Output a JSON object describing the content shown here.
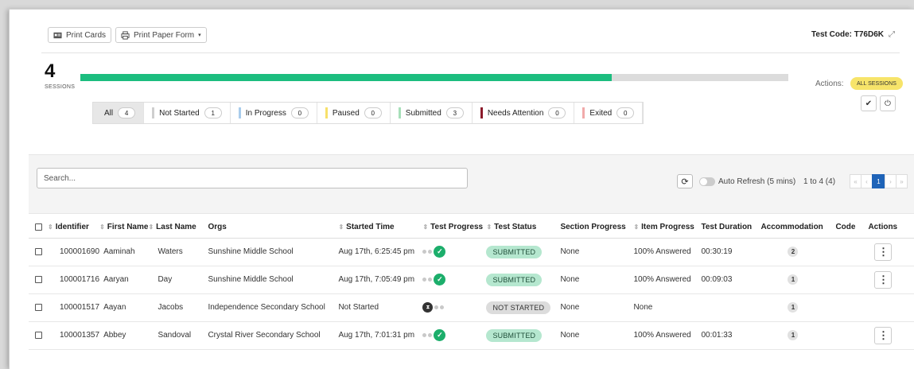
{
  "toolbar": {
    "print_cards": "Print Cards",
    "print_paper_form": "Print Paper Form",
    "test_code_label": "Test Code:",
    "test_code": "T76D6K"
  },
  "summary": {
    "sessions_count": "4",
    "sessions_label": "SESSIONS",
    "progress_fraction": 0.75,
    "actions_label": "Actions:",
    "all_sessions_pill": "ALL SESSIONS"
  },
  "filters": [
    {
      "label": "All",
      "count": "4",
      "color": ""
    },
    {
      "label": "Not Started",
      "count": "1",
      "color": "#cfcfcf"
    },
    {
      "label": "In Progress",
      "count": "0",
      "color": "#a9ccec"
    },
    {
      "label": "Paused",
      "count": "0",
      "color": "#f7e06a"
    },
    {
      "label": "Submitted",
      "count": "3",
      "color": "#a7dfb9"
    },
    {
      "label": "Needs Attention",
      "count": "0",
      "color": "#8b1a2b"
    },
    {
      "label": "Exited",
      "count": "0",
      "color": "#f1aaaa"
    }
  ],
  "search": {
    "placeholder": "Search..."
  },
  "refresh": {
    "auto_label": "Auto Refresh (5 mins)",
    "range_label": "1 to 4 (4)",
    "current_page": "1"
  },
  "table": {
    "headers": {
      "identifier": "Identifier",
      "first_name": "First Name",
      "last_name": "Last Name",
      "orgs": "Orgs",
      "started_time": "Started Time",
      "test_progress": "Test Progress",
      "test_status": "Test Status",
      "section_progress": "Section Progress",
      "item_progress": "Item Progress",
      "test_duration": "Test Duration",
      "accommodation": "Accommodation",
      "code": "Code",
      "actions": "Actions"
    },
    "rows": [
      {
        "identifier": "100001690",
        "first_name": "Aaminah",
        "last_name": "Waters",
        "orgs": "Sunshine Middle School",
        "started_time": "Aug 17th, 6:25:45 pm",
        "status": "SUBMITTED",
        "section_progress": "None",
        "item_progress": "100% Answered",
        "duration": "00:30:19",
        "accommodation": "2"
      },
      {
        "identifier": "100001716",
        "first_name": "Aaryan",
        "last_name": "Day",
        "orgs": "Sunshine Middle School",
        "started_time": "Aug 17th, 7:05:49 pm",
        "status": "SUBMITTED",
        "section_progress": "None",
        "item_progress": "100% Answered",
        "duration": "00:09:03",
        "accommodation": "1"
      },
      {
        "identifier": "100001517",
        "first_name": "Aayan",
        "last_name": "Jacobs",
        "orgs": "Independence Secondary School",
        "started_time": "Not Started",
        "status": "NOT STARTED",
        "section_progress": "None",
        "item_progress": "None",
        "duration": "",
        "accommodation": "1"
      },
      {
        "identifier": "100001357",
        "first_name": "Abbey",
        "last_name": "Sandoval",
        "orgs": "Crystal River Secondary School",
        "started_time": "Aug 17th, 7:01:31 pm",
        "status": "SUBMITTED",
        "section_progress": "None",
        "item_progress": "100% Answered",
        "duration": "00:01:33",
        "accommodation": "1"
      }
    ]
  }
}
